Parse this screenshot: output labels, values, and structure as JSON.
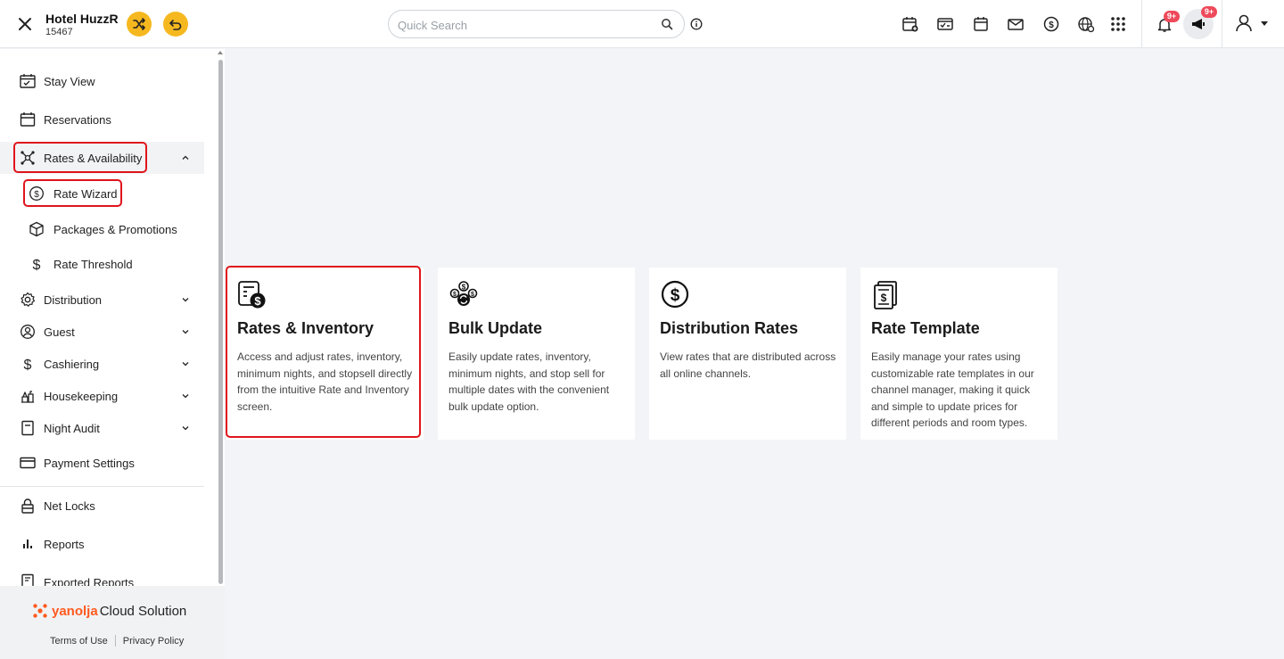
{
  "header": {
    "hotel_name": "Hotel HuzzR",
    "hotel_id": "15467",
    "search_placeholder": "Quick Search",
    "notification_badge": "9+",
    "announcement_badge": "9+"
  },
  "sidebar": {
    "items": [
      {
        "label": "Stay View"
      },
      {
        "label": "Reservations"
      },
      {
        "label": "Rates & Availability"
      },
      {
        "label": "Rate Wizard"
      },
      {
        "label": "Packages & Promotions"
      },
      {
        "label": "Rate Threshold"
      },
      {
        "label": "Distribution"
      },
      {
        "label": "Guest"
      },
      {
        "label": "Cashiering"
      },
      {
        "label": "Housekeeping"
      },
      {
        "label": "Night Audit"
      },
      {
        "label": "Payment Settings"
      },
      {
        "label": "Net Locks"
      },
      {
        "label": "Reports"
      },
      {
        "label": "Exported Reports"
      }
    ],
    "brand_part1": "yanolja",
    "brand_part2": "Cloud Solution",
    "terms": "Terms of Use",
    "privacy": "Privacy Policy"
  },
  "cards": [
    {
      "title": "Rates & Inventory",
      "desc": "Access and adjust rates, inventory, minimum nights, and stopsell directly from the intuitive Rate and Inventory screen."
    },
    {
      "title": "Bulk Update",
      "desc": "Easily update rates, inventory, minimum nights, and stop sell for multiple dates with the convenient bulk update option."
    },
    {
      "title": "Distribution Rates",
      "desc": "View rates that are distributed across all online channels."
    },
    {
      "title": "Rate Template",
      "desc": "Easily manage your rates using customizable rate templates in our channel manager, making it quick and simple to update prices for different periods and room types."
    }
  ],
  "colors": {
    "accent_yellow": "#f6b81f",
    "highlight_red": "#e0141c",
    "badge_red": "#ee4a5a",
    "brand_orange": "#ff5a1f"
  }
}
